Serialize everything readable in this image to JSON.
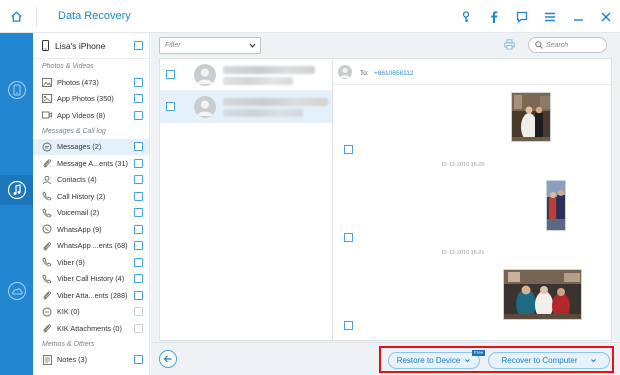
{
  "window": {
    "title": "Data Recovery"
  },
  "device": {
    "name": "Lisa's iPhone"
  },
  "categories": {
    "photos_group": "Photos & Videos",
    "photos": "Photos (473)",
    "app_photos": "App Photos (350)",
    "app_videos": "App Videos (8)",
    "messages_group": "Messages & Call log",
    "messages": "Messages (2)",
    "message_attachments": "Message A...ents (31)",
    "contacts": "Contacts (4)",
    "call_history": "Call History (2)",
    "voicemail": "Voicemail (2)",
    "whatsapp": "WhatsApp (9)",
    "whatsapp_attachments": "WhatsApp ...ents (68)",
    "viber": "Viber (9)",
    "viber_call_history": "Viber Call History (4)",
    "viber_attachments": "Viber Atta...ents (288)",
    "kik": "KIK (0)",
    "kik_attachments": "KIK Attachments (0)",
    "memos_group": "Memos & Others",
    "notes": "Notes (3)"
  },
  "toolbar": {
    "filter_placeholder": "Filter",
    "search_placeholder": "Search"
  },
  "detail": {
    "to_label": "To:",
    "to_number": "+8610658112",
    "timestamp_1": "12-12-2016 15:20",
    "timestamp_2": "12-12-2016 15:21"
  },
  "actions": {
    "restore_to_device": "Restore to Device",
    "free_badge": "Free",
    "recover_to_computer": "Recover to Computer"
  },
  "colors": {
    "accent": "#2286d1",
    "title_text": "#1d87c8",
    "highlight_border": "#e5101a"
  },
  "icons": {
    "home": "home-icon",
    "key": "key-icon",
    "facebook": "facebook-icon",
    "feedback": "feedback-icon",
    "menu": "menu-icon",
    "minimize": "minimize-icon",
    "close": "close-icon"
  }
}
